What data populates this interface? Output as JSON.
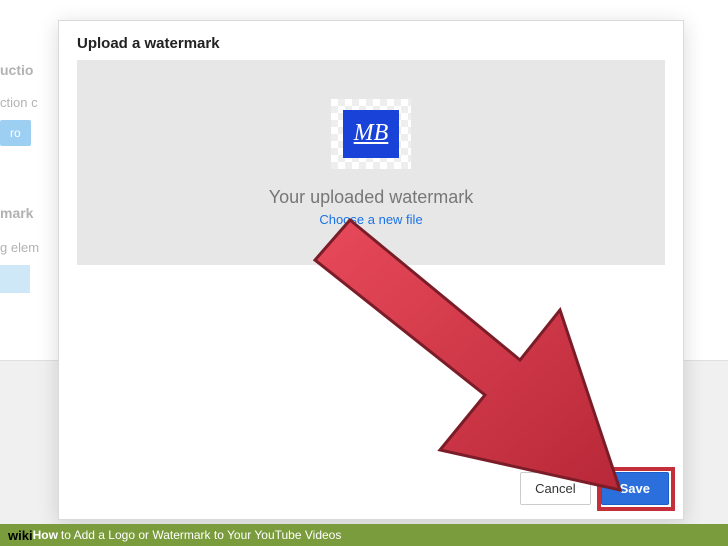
{
  "background": {
    "section1_title": "uctio",
    "section1_desc": "ction c",
    "section1_btn": "ro",
    "section2_title": "mark",
    "section2_desc": "g elem"
  },
  "modal": {
    "title": "Upload a watermark",
    "logo_text": "MB",
    "uploaded_label": "Your uploaded watermark",
    "choose_link": "Choose a new file",
    "cancel_label": "Cancel",
    "save_label": "Save"
  },
  "caption": {
    "wiki": "wiki",
    "how": "How",
    "title": " to Add a Logo or Watermark to Your YouTube Videos"
  }
}
